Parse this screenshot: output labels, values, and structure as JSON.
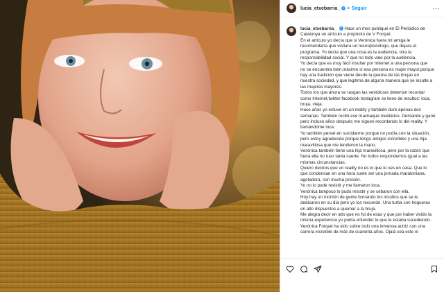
{
  "post": {
    "username": "lucia_etxebarria_",
    "separator": "•",
    "follow_label": "Seguir",
    "more_label": "···"
  },
  "caption": {
    "username": "lucia_etxebarria_",
    "lines": [
      " Hace un mes publiqué en El Periódico de",
      "Catalunya un artículo a propósito de V Forqué.",
      "En el artículo yo decía que si Verónica fuera mi amiga le",
      "recomendaría que visitara un neuropsicólogo, que dejara el",
      "programa. Yo decía que una cosa es la audiencia, otra la",
      "responsabilidad social. Y que no todo vale por la audiencia.",
      "Yo decía que es muy fácil insultar por Internet a una persona que",
      "no se encuentra bien,máxime si esa persona es mujer mayor,porque",
      "hay una tradición que viene desde la quema de las brujas en",
      "nuestra sociedad, y que legitima de alguna manera que se insulte a",
      "las mujeres mayores.",
      "Todos los que ahora se rasgan las vestiduras deberían recordar",
      "como Internet,twitter facebook Instagram se lleno de insultos: loca,",
      "bruja. vieja.",
      "Hace años yo estuve en un reality y también duré apenas dos",
      "semanas. También recibí ese machaque mediático. Demandé y gané",
      "pero incluso años después me siguen recordando lo del reality. Y",
      "llamándome loca.",
      "Yo también pensé en suicidarme porque no podía con la situación,",
      "pero estoy agradecida porque tengo amigos increíbles y una hija",
      "maravillosa que me tendieron la mano.",
      "Verónica también tiene una hija maravillosa. pero por la razón que",
      "fuera ella no tuvo tanta suerte. No todos respondemos igual a las",
      "mismas circunstancias.",
      "Quiero deciros que un reality no es lo que tú ves en casa. Que lo",
      "que condensan en una hora suele ser una jornada maratoniana,",
      "agotadora, con mucha presión.",
      "Yo no lo pude resistir y me llamaron loca.",
      "Verónica tampoco lo pudo resistir y se cebaron con ella.",
      "Hoy hay un montón de gente borrando los insultos que se le",
      "dedicaron en su día pero yo los recuerdo. Una turba con hogueras",
      "en alto dispuestos a quemar a la bruja.",
      "Me alegra decir en alto que no fui de esas y que por haber vivido la",
      "misma experiencia yo podía entender lo que le estaba sucediendo.",
      "Verónica Forqué ha sido sobre todo una inmensa actriz con una",
      "carrera increíble de más de cuarenta años. Ojalá sea este el"
    ]
  },
  "icons": {
    "verified": "verified-badge-icon",
    "like": "heart-icon",
    "comment": "comment-bubble-icon",
    "share": "paper-plane-icon",
    "save": "bookmark-icon"
  },
  "colors": {
    "accent": "#0095f6",
    "verified": "#3897f0",
    "text": "#262626",
    "border": "#dbdbdb"
  }
}
